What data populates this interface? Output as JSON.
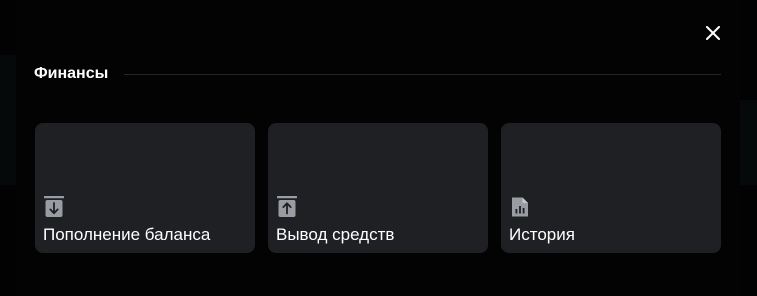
{
  "finance": {
    "title": "Финансы",
    "cards": [
      {
        "label": "Пополнение баланса",
        "icon": "deposit-icon"
      },
      {
        "label": "Вывод средств",
        "icon": "withdraw-icon"
      },
      {
        "label": "История",
        "icon": "history-icon"
      }
    ]
  },
  "colors": {
    "card_background": "#1f2023",
    "text": "#ffffff",
    "icon": "#9a9ca3"
  }
}
